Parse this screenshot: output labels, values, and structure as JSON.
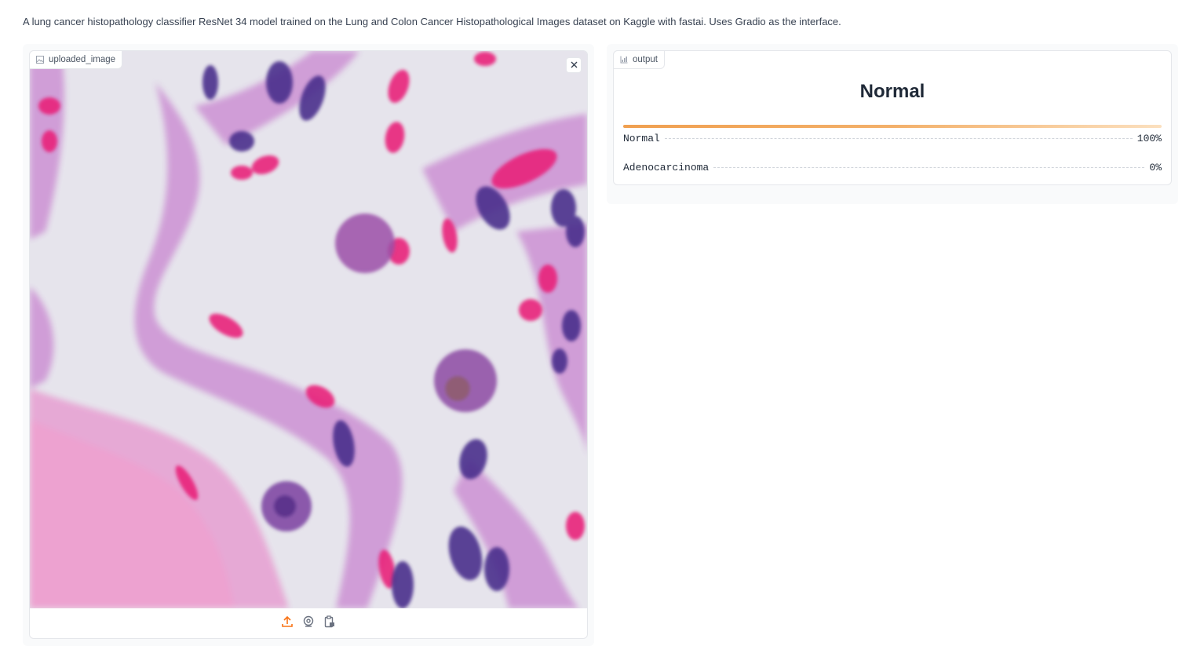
{
  "description": "A lung cancer histopathology classifier ResNet 34 model trained on the Lung and Colon Cancer Histopathological Images dataset on Kaggle with fastai. Uses Gradio as the interface.",
  "input": {
    "label": "uploaded_image",
    "label_icon": "image-icon",
    "close_icon": "close-icon",
    "sources": [
      {
        "name": "upload-icon",
        "color": "#f97316"
      },
      {
        "name": "webcam-icon",
        "color": "#6b7280"
      },
      {
        "name": "clipboard-icon",
        "color": "#6b7280"
      }
    ]
  },
  "output": {
    "label": "output",
    "label_icon": "label-icon",
    "predicted_label": "Normal",
    "top_confidence": 1.0,
    "confidences": [
      {
        "label": "Normal",
        "value": "100%"
      },
      {
        "label": "Adenocarcinoma",
        "value": "0%"
      }
    ]
  },
  "colors": {
    "accent": "#f97316",
    "bar_start": "#f0a050",
    "bar_end": "#fbe0bf"
  }
}
